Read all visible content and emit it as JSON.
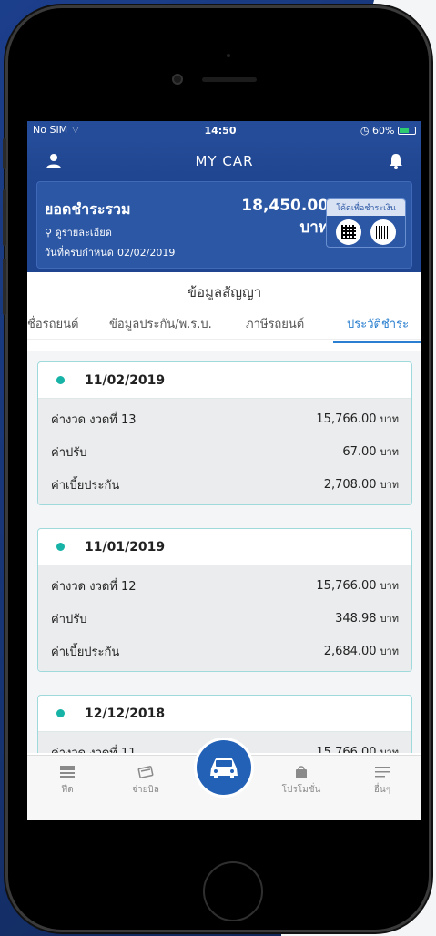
{
  "status_bar": {
    "carrier": "No SIM",
    "time": "14:50",
    "battery": "60%"
  },
  "navbar": {
    "title": "MY CAR"
  },
  "summary": {
    "label": "ยอดชำระรวม",
    "amount": "18,450.00 บาท",
    "detail_link": "ดูรายละเอียด",
    "due_label": "วันที่ครบกำหนด",
    "due_date": "02/02/2019",
    "pay_code_label": "โค้ดเพื่อชำระเงิน"
  },
  "section_title": "ข้อมูลสัญญา",
  "tabs": [
    {
      "label": "ชื่อรถยนต์"
    },
    {
      "label": "ข้อมูลประกัน/พ.ร.บ."
    },
    {
      "label": "ภาษีรถยนต์"
    },
    {
      "label": "ประวัติชำระ",
      "active": true
    }
  ],
  "history": [
    {
      "date": "11/02/2019",
      "rows": [
        {
          "label": "ค่างวด งวดที่ 13",
          "amount": "15,766.00",
          "unit": "บาท"
        },
        {
          "label": "ค่าปรับ",
          "amount": "67.00",
          "unit": "บาท"
        },
        {
          "label": "ค่าเบี้ยประกัน",
          "amount": "2,708.00",
          "unit": "บาท"
        }
      ]
    },
    {
      "date": "11/01/2019",
      "rows": [
        {
          "label": "ค่างวด งวดที่ 12",
          "amount": "15,766.00",
          "unit": "บาท"
        },
        {
          "label": "ค่าปรับ",
          "amount": "348.98",
          "unit": "บาท"
        },
        {
          "label": "ค่าเบี้ยประกัน",
          "amount": "2,684.00",
          "unit": "บาท"
        }
      ]
    },
    {
      "date": "12/12/2018",
      "rows": [
        {
          "label": "ค่างวด งวดที่ 11",
          "amount": "15,766.00",
          "unit": "บาท"
        }
      ]
    }
  ],
  "tabbar": {
    "feed": "ฟีด",
    "pay_bill": "จ่ายบิล",
    "promotion": "โปรโมชั่น",
    "more": "อื่นๆ"
  },
  "colors": {
    "primary": "#1f4490",
    "accent": "#2a7fd0",
    "teal": "#17b3a6"
  }
}
